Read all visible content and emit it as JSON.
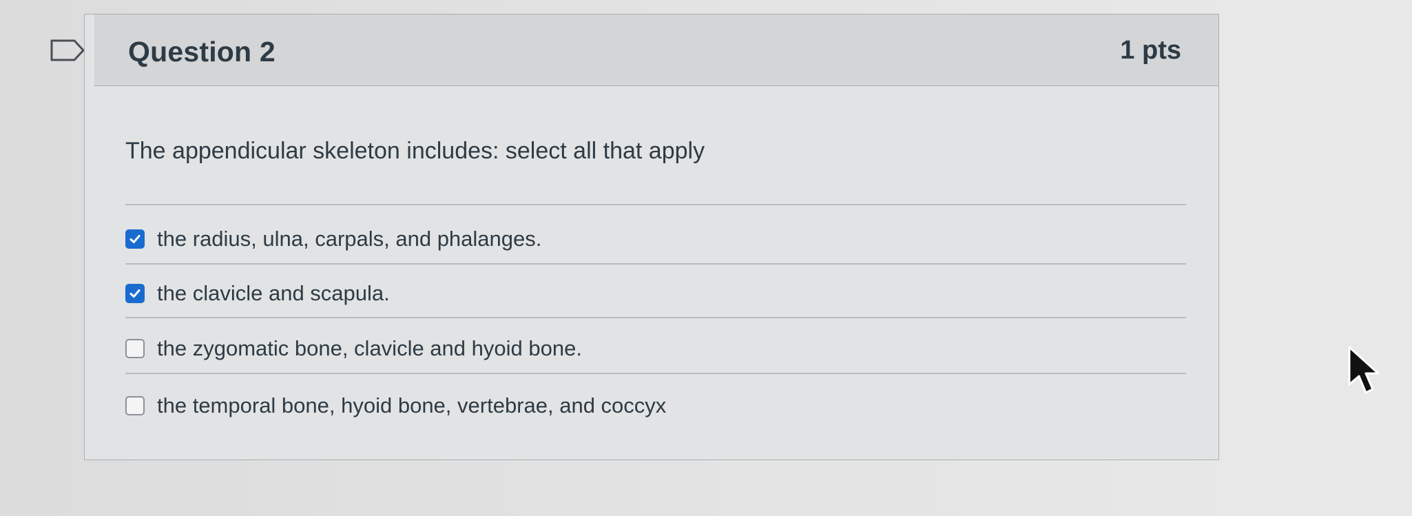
{
  "question": {
    "title": "Question 2",
    "points": "1 pts",
    "prompt": "The appendicular skeleton includes:  select all that apply"
  },
  "answers": [
    {
      "label": "the radius, ulna, carpals, and phalanges.",
      "checked": true
    },
    {
      "label": "the clavicle and scapula.",
      "checked": true
    },
    {
      "label": "the zygomatic bone, clavicle and hyoid bone.",
      "checked": false
    },
    {
      "label": "the temporal bone, hyoid bone, vertebrae, and coccyx",
      "checked": false
    }
  ],
  "icons": {
    "flag": "flag-icon",
    "checkbox": "checkbox-icon",
    "check": "check-icon",
    "cursor": "mouse-cursor-icon"
  },
  "colors": {
    "accent": "#1a6bd0",
    "text": "#2d3b45",
    "border": "#a9aeb2"
  }
}
